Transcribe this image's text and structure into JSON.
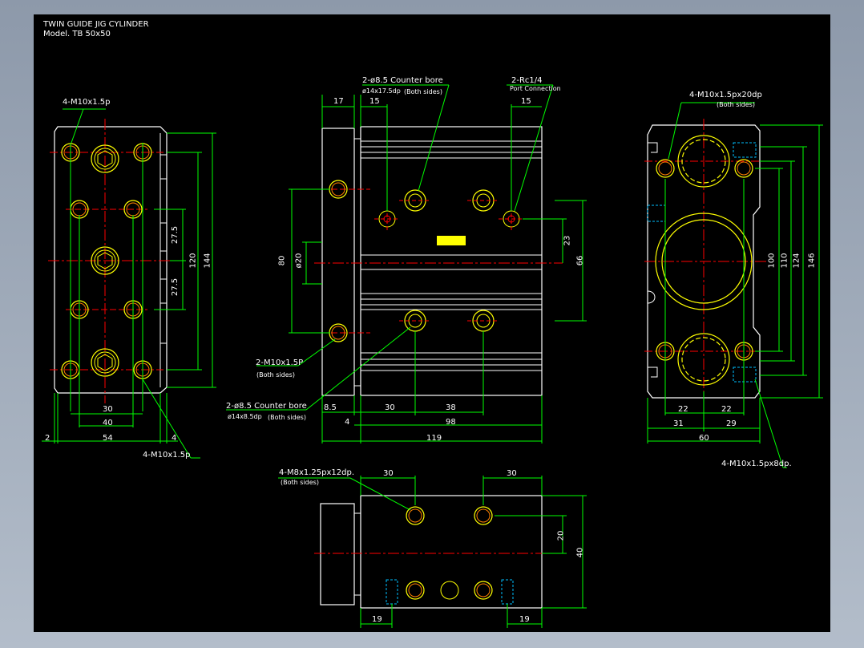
{
  "title": {
    "line1": "TWIN GUIDE JIG CYLINDER",
    "line2": "Model. TB 50x50"
  },
  "colors": {
    "background": "#000000",
    "part": "#ffffff",
    "dimension": "#00ff00",
    "hole": "#ffff00",
    "centerline": "#ff0000",
    "hidden": "#00bfff"
  },
  "annotations": {
    "m10_front": "4-M10x1.5p",
    "m10_front_bottom": "4-M10x1.5p",
    "counterbore_top": "2-ø8.5 Counter bore",
    "counterbore_top_sub": "ø14x17.5dp",
    "both_sides": "(Both sides)",
    "port": "2-Rc1/4",
    "port_sub": "Port Connection",
    "m10_side": "2-M10x1.5P",
    "counterbore_bottom": "2-ø8.5 Counter bore",
    "counterbore_bottom_sub": "ø14x8.5dp",
    "m10_right_top": "4-M10x1.5px20dp",
    "m10_right_bottom": "4-M10x1.5px8dp.",
    "m8_bottom": "4-M8x1.25px12dp."
  },
  "dims_front": {
    "d30": "30",
    "d40": "40",
    "d54": "54",
    "d2": "2",
    "d4": "4",
    "d27a": "27.5",
    "d27b": "27.5",
    "d120": "120",
    "d144": "144"
  },
  "dims_side": {
    "d17": "17",
    "d15a": "15",
    "d15b": "15",
    "d80": "80",
    "d20": "ø20",
    "d23": "23",
    "d66": "66",
    "d85": "8.5",
    "d4": "4",
    "d30": "30",
    "d38": "38",
    "d98": "98",
    "d119": "119"
  },
  "dims_right": {
    "d22a": "22",
    "d22b": "22",
    "d31": "31",
    "d29": "29",
    "d60": "60",
    "d100": "100",
    "d110": "110",
    "d124": "124",
    "d146": "146"
  },
  "dims_bottom": {
    "d30a": "30",
    "d30b": "30",
    "d20": "20",
    "d40": "40",
    "d19a": "19",
    "d19b": "19"
  }
}
